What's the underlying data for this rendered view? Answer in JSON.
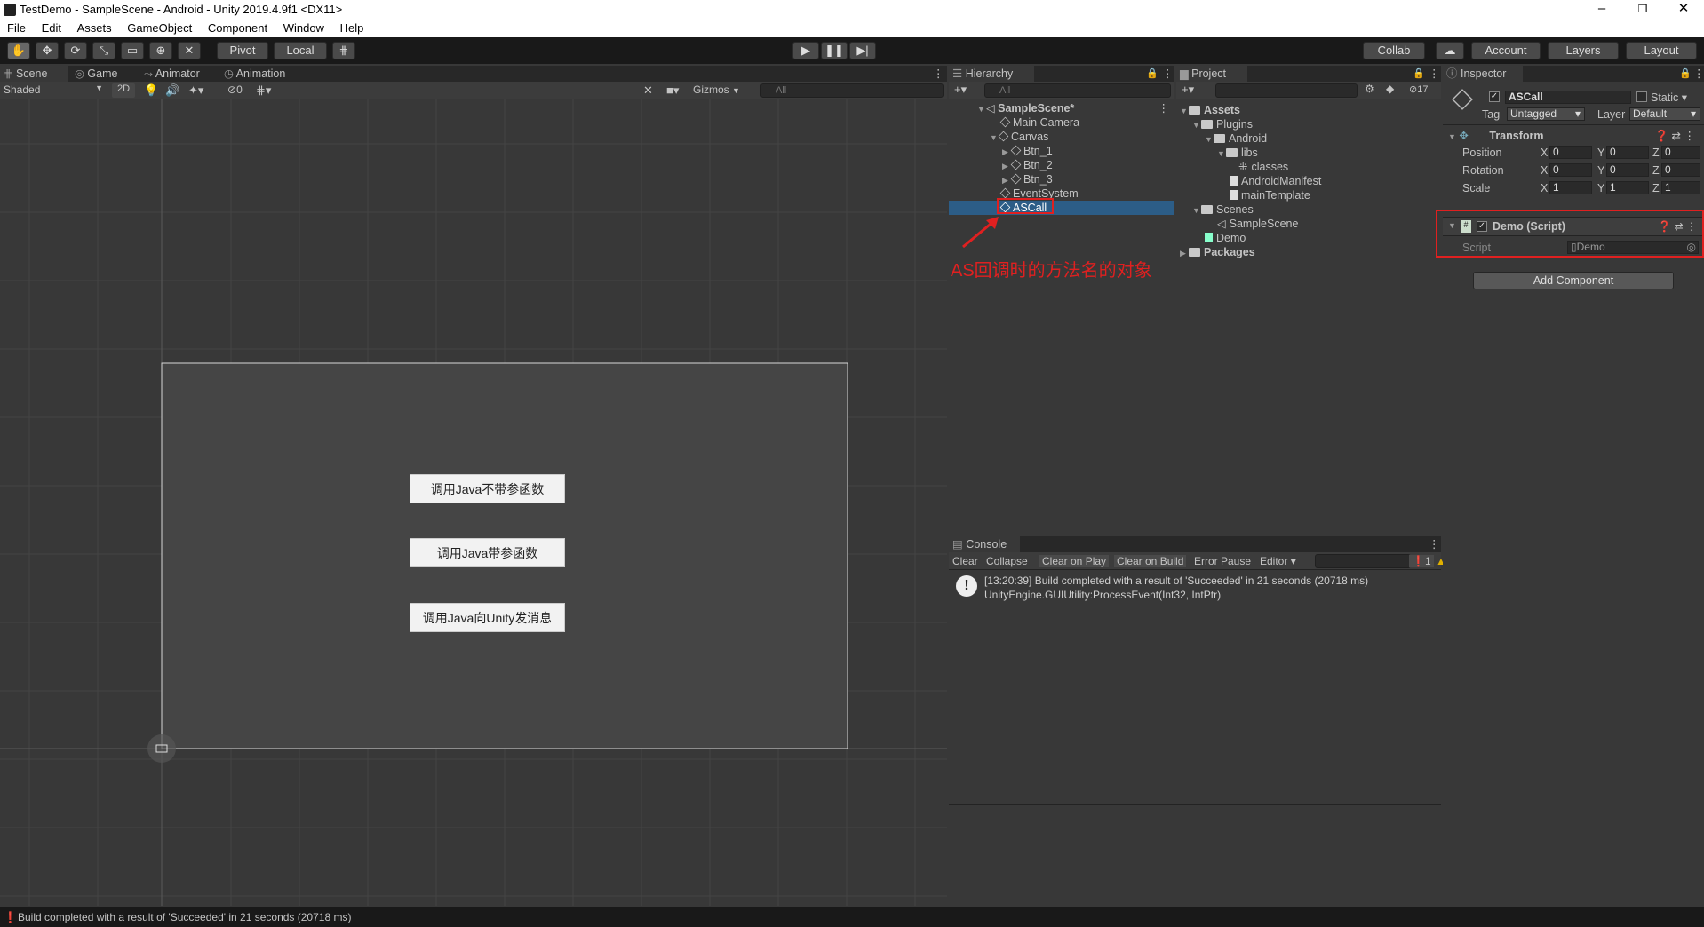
{
  "window": {
    "title": "TestDemo - SampleScene - Android - Unity 2019.4.9f1 <DX11>"
  },
  "menu": [
    "File",
    "Edit",
    "Assets",
    "GameObject",
    "Component",
    "Window",
    "Help"
  ],
  "toolbar": {
    "pivot": "Pivot",
    "local": "Local",
    "collab": "Collab",
    "account": "Account",
    "layers": "Layers",
    "layout": "Layout"
  },
  "scene": {
    "tabs": [
      "Scene",
      "Game",
      "Animator",
      "Animation"
    ],
    "shading": "Shaded",
    "mode2d": "2D",
    "hidden_count": "0",
    "gizmos": "Gizmos",
    "search_placeholder": "All",
    "buttons": [
      "调用Java不带参函数",
      "调用Java带参函数",
      "调用Java向Unity发消息"
    ]
  },
  "hierarchy": {
    "tab": "Hierarchy",
    "search_placeholder": "All",
    "items": [
      "SampleScene*",
      "Main Camera",
      "Canvas",
      "Btn_1",
      "Btn_2",
      "Btn_3",
      "EventSystem",
      "ASCall"
    ],
    "annotation": "AS回调时的方法名的对象"
  },
  "project": {
    "tab": "Project",
    "count": "17",
    "items": [
      "Assets",
      "Plugins",
      "Android",
      "libs",
      "classes",
      "AndroidManifest",
      "mainTemplate",
      "Scenes",
      "SampleScene",
      "Demo",
      "Packages"
    ]
  },
  "console": {
    "tab": "Console",
    "buttons": [
      "Clear",
      "Collapse",
      "Clear on Play",
      "Clear on Build",
      "Error Pause",
      "Editor"
    ],
    "count": "1",
    "messages": [
      "[13:20:39] Build completed with a result of 'Succeeded' in 21 seconds (20718 ms)",
      "UnityEngine.GUIUtility:ProcessEvent(Int32, IntPtr)"
    ]
  },
  "inspector": {
    "tab": "Inspector",
    "object_name": "ASCall",
    "static": "Static",
    "tag_label": "Tag",
    "tag": "Untagged",
    "layer_label": "Layer",
    "layer": "Default",
    "transform": {
      "title": "Transform",
      "rows": [
        {
          "label": "Position",
          "x": "0",
          "y": "0",
          "z": "0"
        },
        {
          "label": "Rotation",
          "x": "0",
          "y": "0",
          "z": "0"
        },
        {
          "label": "Scale",
          "x": "1",
          "y": "1",
          "z": "1"
        }
      ]
    },
    "script_comp": {
      "title": "Demo (Script)",
      "script_label": "Script",
      "script_value": "Demo"
    },
    "add_component": "Add Component",
    "axes": [
      "X",
      "Y",
      "Z"
    ]
  },
  "status": "Build completed with a result of 'Succeeded' in 21 seconds (20718 ms)"
}
